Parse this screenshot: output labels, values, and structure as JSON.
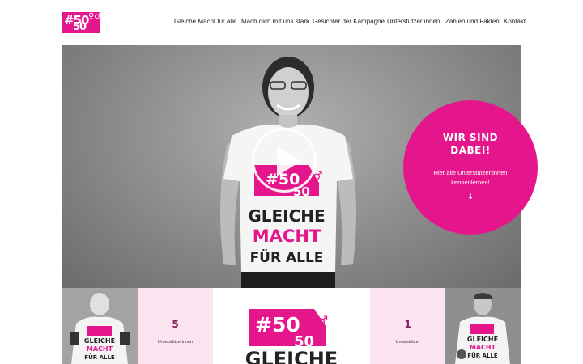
{
  "header": {
    "logo": {
      "line1": "#50",
      "line2": "50",
      "symbols": "♀♂"
    },
    "nav": [
      {
        "label": "Gleiche Macht für alle"
      },
      {
        "label": "Mach dich mit uns stark"
      },
      {
        "label": "Gesichter der Kampagne"
      },
      {
        "label": "Unterstützer:innen"
      },
      {
        "label": "Zahlen und Fakten"
      },
      {
        "label": "Kontakt"
      }
    ]
  },
  "hero": {
    "shirt": {
      "logo": "#50 50",
      "line1": "GLEICHE",
      "line2": "MACHT",
      "line3": "FÜR ALLE"
    },
    "badge": {
      "title_line1": "WIR SIND",
      "title_line2": "DABEI!",
      "text_line1": "Hier alle Unterstützer:innen",
      "text_line2": "kennenlernen!",
      "arrow": "↓"
    }
  },
  "strip": {
    "left_stat": {
      "number": "5",
      "label": "Unterstützerinnen"
    },
    "right_stat": {
      "number": "1",
      "label": "Unterstützer"
    },
    "center_logo": {
      "text": "#50 50",
      "word": "GLEICHE"
    },
    "left_thumb_shirt": {
      "line1": "GLEICHE",
      "line2": "MACHT",
      "line3": "FÜR ALLE"
    },
    "right_thumb_shirt": {
      "line1": "GLEICHE",
      "line2": "MACHT",
      "line3": "FÜR ALLE"
    }
  },
  "colors": {
    "accent": "#e5168c",
    "pale_pink": "#fbe3f0",
    "stat_number": "#8a1c5c"
  }
}
